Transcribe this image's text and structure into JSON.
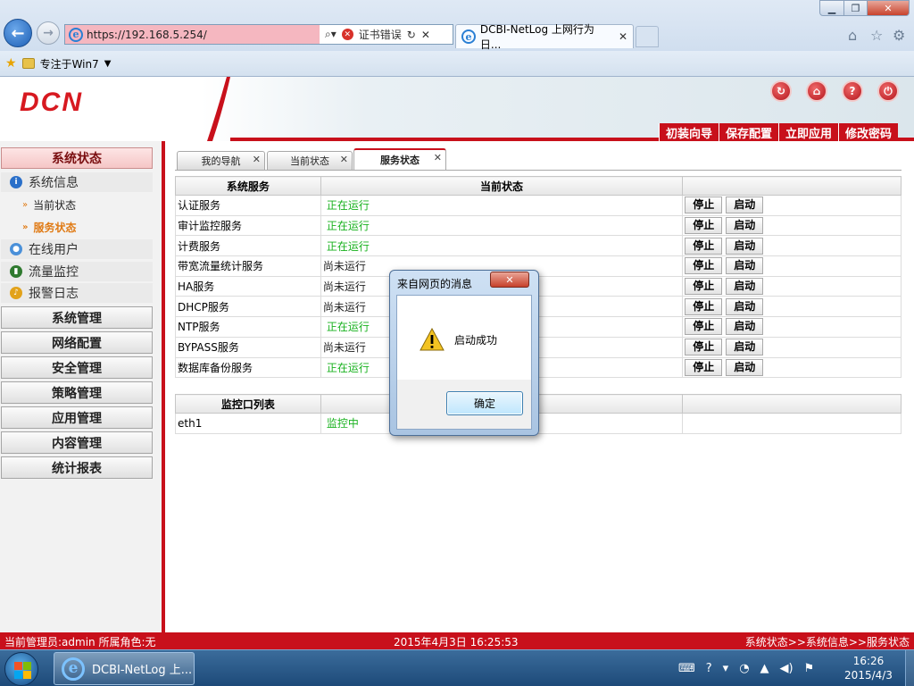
{
  "browser": {
    "url": "https://192.168.5.254/",
    "cert_error": "证书错误",
    "tab_title": "DCBI-NetLog 上网行为日...",
    "favorites_item": "专注于Win7"
  },
  "app": {
    "logo": "DCN",
    "header_menu": [
      "初装向导",
      "保存配置",
      "立即应用",
      "修改密码"
    ]
  },
  "sidebar": {
    "top_button": "系统状态",
    "items": [
      {
        "label": "系统信息"
      },
      {
        "label": "在线用户"
      },
      {
        "label": "流量监控"
      },
      {
        "label": "报警日志"
      }
    ],
    "sub_items": [
      {
        "label": "当前状态"
      },
      {
        "label": "服务状态"
      }
    ],
    "buttons": [
      "系统管理",
      "网络配置",
      "安全管理",
      "策略管理",
      "应用管理",
      "内容管理",
      "统计报表"
    ]
  },
  "content_tabs": [
    {
      "label": "我的导航"
    },
    {
      "label": "当前状态"
    },
    {
      "label": "服务状态"
    }
  ],
  "services_table": {
    "headers": [
      "系统服务",
      "当前状态",
      ""
    ],
    "rows": [
      {
        "service": "认证服务",
        "status": "正在运行"
      },
      {
        "service": "审计监控服务",
        "status": "正在运行"
      },
      {
        "service": "计费服务",
        "status": "正在运行"
      },
      {
        "service": "带宽流量统计服务",
        "status": "尚未运行"
      },
      {
        "service": "HA服务",
        "status": "尚未运行"
      },
      {
        "service": "DHCP服务",
        "status": "尚未运行"
      },
      {
        "service": "NTP服务",
        "status": "正在运行"
      },
      {
        "service": "BYPASS服务",
        "status": "尚未运行"
      },
      {
        "service": "数据库备份服务",
        "status": "正在运行"
      }
    ],
    "stop_label": "停止",
    "start_label": "启动"
  },
  "monitor_table": {
    "headers": [
      "监控口列表",
      "",
      ""
    ],
    "rows": [
      {
        "port": "eth1",
        "status": "监控中"
      }
    ]
  },
  "dialog": {
    "title": "来自网页的消息",
    "message": "启动成功",
    "ok_label": "确定"
  },
  "status_bar": {
    "admin": "当前管理员:admin  所属角色:无",
    "datetime": "2015年4月3日  16:25:53",
    "breadcrumb": "系统状态>>系统信息>>服务状态"
  },
  "taskbar": {
    "task_label": "DCBI-NetLog 上...",
    "time": "16:26",
    "date": "2015/4/3"
  },
  "colors": {
    "brand_red": "#c8101b",
    "running_green": "#19b21f",
    "active_orange": "#e07a14"
  }
}
